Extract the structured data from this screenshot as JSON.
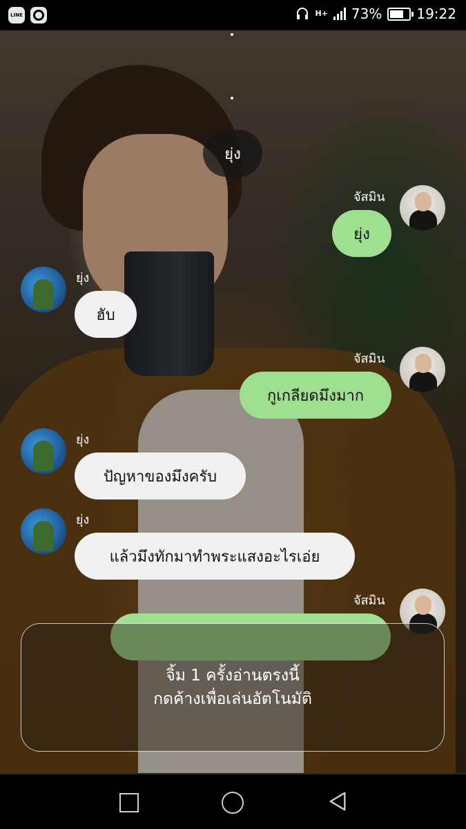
{
  "status_bar": {
    "battery_percent": "73%",
    "battery_level": 0.73,
    "time": "19:22",
    "network": "H+",
    "left_icons": [
      "line-app-icon",
      "camera-app-icon"
    ],
    "line_icon_label": "LINE"
  },
  "chat": {
    "top_bubble": "ยุ่ง",
    "messages": [
      {
        "sender": "จัสมิน",
        "side": "right",
        "text": "ยุ่ง"
      },
      {
        "sender": "ยุ่ง",
        "side": "left",
        "text": "ฮับ"
      },
      {
        "sender": "จัสมิน",
        "side": "right",
        "text": "กูเกลียดมึงมาก"
      },
      {
        "sender": "ยุ่ง",
        "side": "left",
        "text": "ปัญหาของมึงครับ"
      },
      {
        "sender": "ยุ่ง",
        "side": "left",
        "text": "แล้วมึงทักมาทำพระแสงอะไรเอ่ย"
      },
      {
        "sender": "จัสมิน",
        "side": "right",
        "text": ""
      }
    ]
  },
  "hint": {
    "line1": "จิ้ม 1 ครั้งอ่านตรงนี้",
    "line2": "กดค้างเพื่อเล่นอัตโนมัติ"
  },
  "nav": {
    "icons": [
      "recent-apps-icon",
      "home-icon",
      "back-icon"
    ]
  }
}
